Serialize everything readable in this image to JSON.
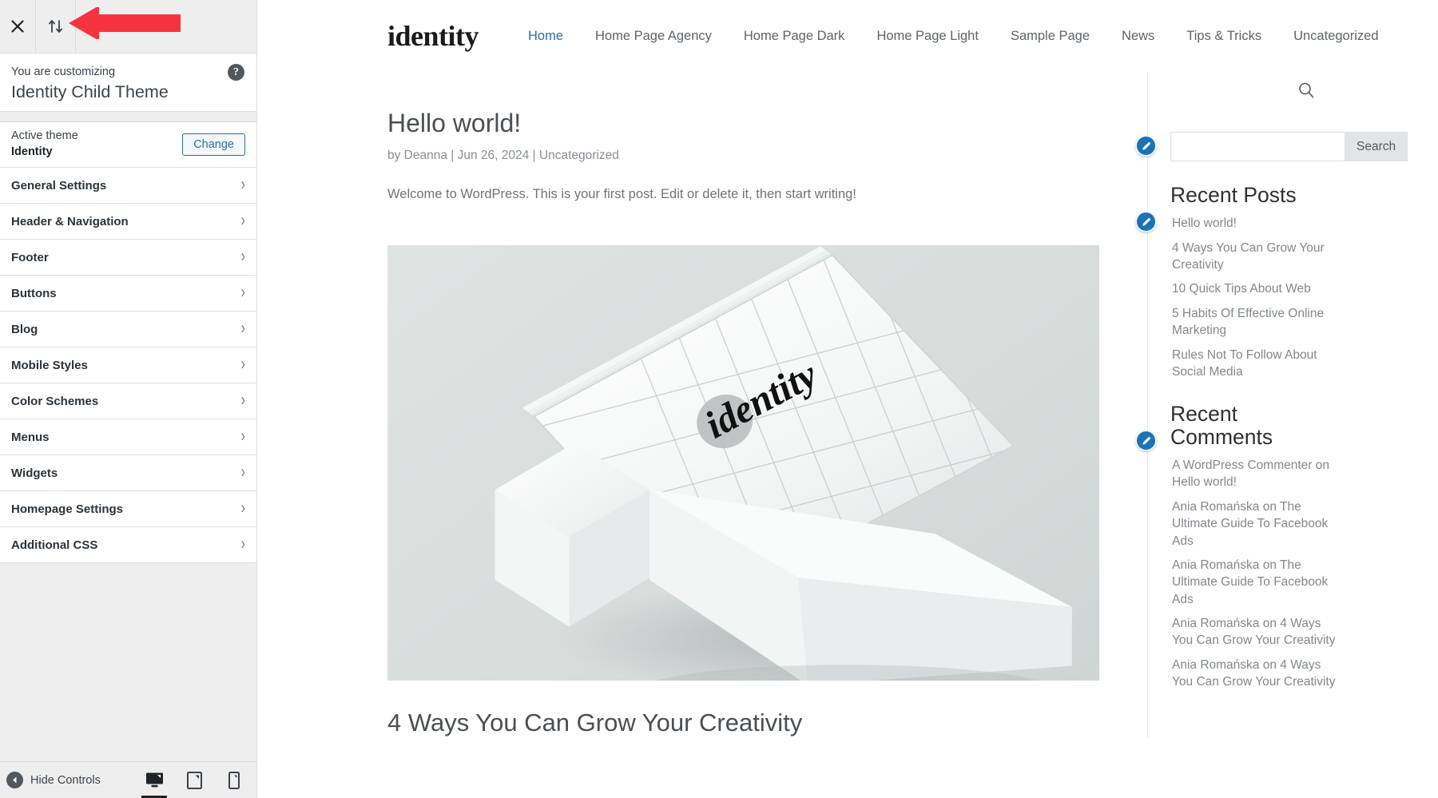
{
  "customizer": {
    "close_icon": "close-icon",
    "collapse_icon": "collapse-sort-icon",
    "help_icon": "help-icon",
    "customizing_label": "You are customizing",
    "theme_name": "Identity Child Theme",
    "active_theme_label": "Active theme",
    "active_theme_name": "Identity",
    "change_button": "Change",
    "sections": [
      {
        "label": "General Settings"
      },
      {
        "label": "Header & Navigation"
      },
      {
        "label": "Footer"
      },
      {
        "label": "Buttons"
      },
      {
        "label": "Blog"
      },
      {
        "label": "Mobile Styles"
      },
      {
        "label": "Color Schemes"
      },
      {
        "label": "Menus"
      },
      {
        "label": "Widgets"
      },
      {
        "label": "Homepage Settings"
      },
      {
        "label": "Additional CSS"
      }
    ],
    "hide_controls_label": "Hide Controls",
    "devices": [
      {
        "name": "desktop-preview-button",
        "active": true
      },
      {
        "name": "tablet-preview-button",
        "active": false
      },
      {
        "name": "mobile-preview-button",
        "active": false
      }
    ],
    "accent_blue": "#2271b1",
    "panel_bg": "#eeeeee",
    "annotation_arrow_color": "#f5333f"
  },
  "site": {
    "logo": "identity",
    "nav": [
      {
        "label": "Home",
        "active": true
      },
      {
        "label": "Home Page Agency",
        "active": false
      },
      {
        "label": "Home Page Dark",
        "active": false
      },
      {
        "label": "Home Page Light",
        "active": false
      },
      {
        "label": "Sample Page",
        "active": false
      },
      {
        "label": "News",
        "active": false
      },
      {
        "label": "Tips & Tricks",
        "active": false
      },
      {
        "label": "Uncategorized",
        "active": false
      }
    ]
  },
  "post": {
    "title": "Hello world!",
    "meta": "by Deanna | Jun 26, 2024 | Uncategorized",
    "paragraph": "Welcome to WordPress. This is your first post. Edit or delete it, then start writing!",
    "featured_image_logo": "identity",
    "next_post_title": "4 Ways You Can Grow Your Creativity"
  },
  "sidebar": {
    "search_icon": "search-icon",
    "search": {
      "value": "",
      "placeholder": "",
      "button_label": "Search"
    },
    "recent_posts": {
      "title": "Recent Posts",
      "items": [
        "Hello world!",
        "4 Ways You Can Grow Your Creativity",
        "10 Quick Tips About Web",
        "5 Habits Of Effective Online Marketing",
        "Rules Not To Follow About Social Media"
      ]
    },
    "recent_comments": {
      "title": "Recent Comments",
      "items": [
        "A WordPress Commenter on Hello world!",
        "Ania Romańska on The Ultimate Guide To Facebook Ads",
        "Ania Romańska on The Ultimate Guide To Facebook Ads",
        "Ania Romańska on 4 Ways You Can Grow Your Creativity",
        "Ania Romańska on 4 Ways You Can Grow Your Creativity"
      ]
    },
    "edit_icon": "edit-pencil-icon",
    "edit_icon_color": "#1a73b7"
  }
}
